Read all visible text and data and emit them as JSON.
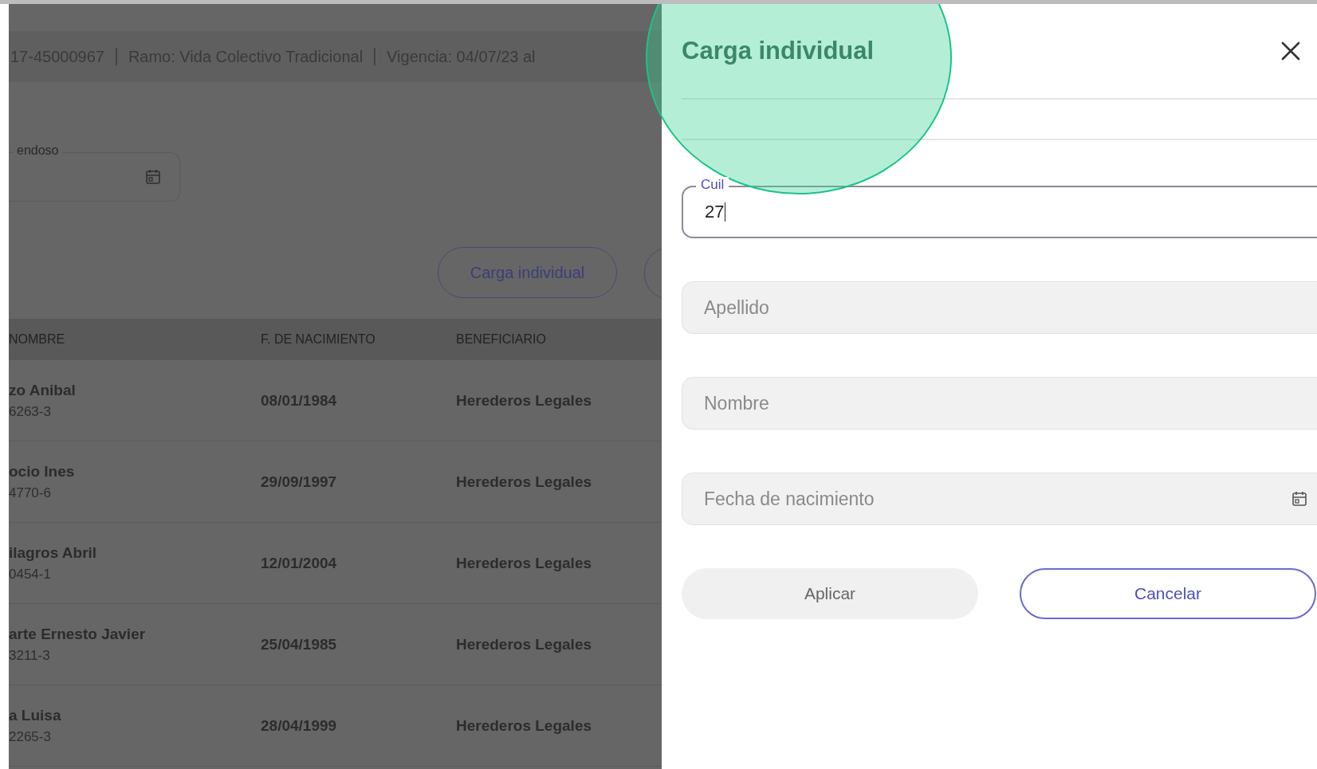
{
  "header_bar": {
    "items": [
      "17-45000967",
      "Ramo: Vida Colectivo Tradicional",
      "Vigencia: 04/07/23 al"
    ]
  },
  "date_field": {
    "label": "endoso"
  },
  "actions": [
    "Carga individual"
  ],
  "table": {
    "columns": [
      "NOMBRE",
      "F. DE NACIMIENTO",
      "BENEFICIARIO"
    ],
    "rows": [
      {
        "name": "zo Anibal",
        "id": "6263-3",
        "birth": "08/01/1984",
        "beneficiary": "Herederos Legales"
      },
      {
        "name": "ocio Ines",
        "id": "4770-6",
        "birth": "29/09/1997",
        "beneficiary": "Herederos Legales"
      },
      {
        "name": "ilagros Abril",
        "id": "0454-1",
        "birth": "12/01/2004",
        "beneficiary": "Herederos Legales"
      },
      {
        "name": "arte Ernesto Javier",
        "id": "3211-3",
        "birth": "25/04/1985",
        "beneficiary": "Herederos Legales"
      },
      {
        "name": "a Luisa",
        "id": "2265-3",
        "birth": "28/04/1999",
        "beneficiary": "Herederos Legales"
      }
    ]
  },
  "drawer": {
    "title": "Carga individual",
    "fields": [
      {
        "kind": "text",
        "label": "Cuil",
        "value": "27",
        "disabled": false
      },
      {
        "kind": "text",
        "placeholder": "Apellido",
        "disabled": true
      },
      {
        "kind": "text",
        "placeholder": "Nombre",
        "disabled": true
      },
      {
        "kind": "date",
        "placeholder": "Fecha de nacimiento",
        "disabled": true
      }
    ],
    "buttons": [
      {
        "label": "Aplicar",
        "kind": "primary",
        "disabled": true
      },
      {
        "label": "Cancelar",
        "kind": "outline",
        "disabled": false
      }
    ]
  }
}
